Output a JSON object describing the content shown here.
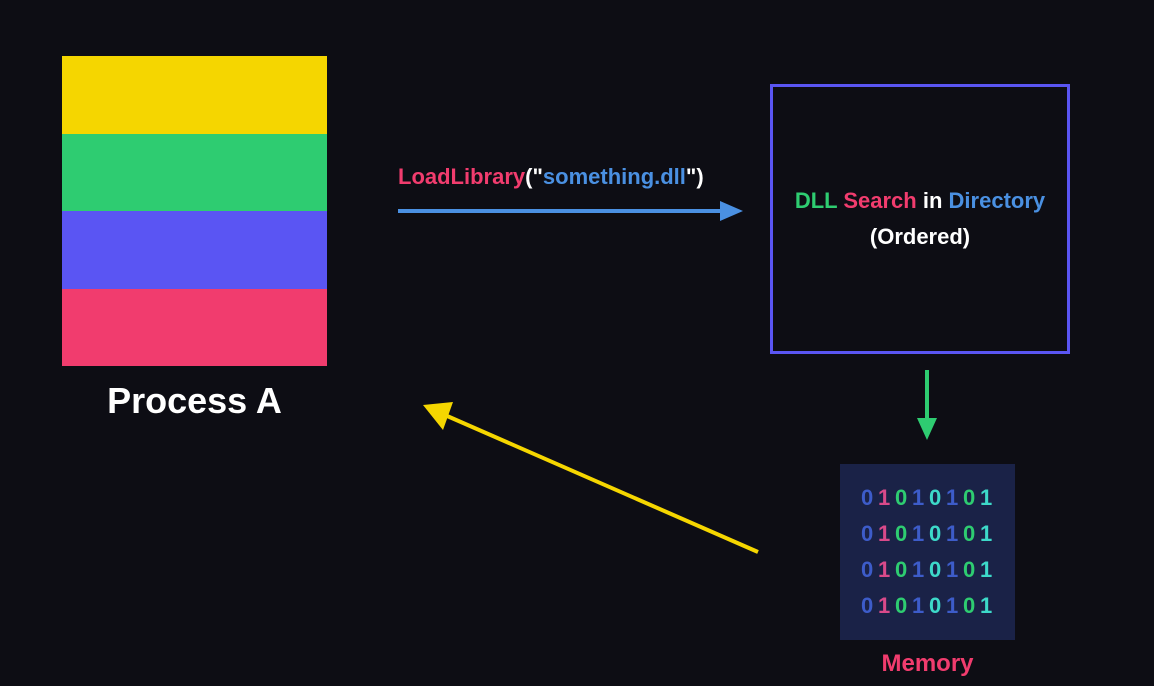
{
  "process": {
    "label": "Process A",
    "stripes": [
      "#f5d600",
      "#2ecc71",
      "#5a55f3",
      "#f13c6e"
    ]
  },
  "loadlib": {
    "func": "LoadLibrary",
    "open": "(\"",
    "arg": "something.dll",
    "close": "\")"
  },
  "searchbox": {
    "w1": "DLL",
    "w2": "Search",
    "w3": "in",
    "w4": "Directory",
    "sub": "(Ordered)"
  },
  "memory": {
    "label": "Memory",
    "rows": [
      [
        "0",
        "1",
        "0",
        "1",
        "0",
        "1",
        "0",
        "1"
      ],
      [
        "0",
        "1",
        "0",
        "1",
        "0",
        "1",
        "0",
        "1"
      ],
      [
        "0",
        "1",
        "0",
        "1",
        "0",
        "1",
        "0",
        "1"
      ],
      [
        "0",
        "1",
        "0",
        "1",
        "0",
        "1",
        "0",
        "1"
      ]
    ],
    "bit_colors": [
      "b-blue",
      "b-pink",
      "b-green",
      "b-blue",
      "b-teal",
      "b-blue",
      "b-green",
      "b-teal"
    ]
  },
  "colors": {
    "arrow_blue": "#4a90e2",
    "arrow_green": "#2ecc71",
    "arrow_yellow": "#f5d600"
  }
}
